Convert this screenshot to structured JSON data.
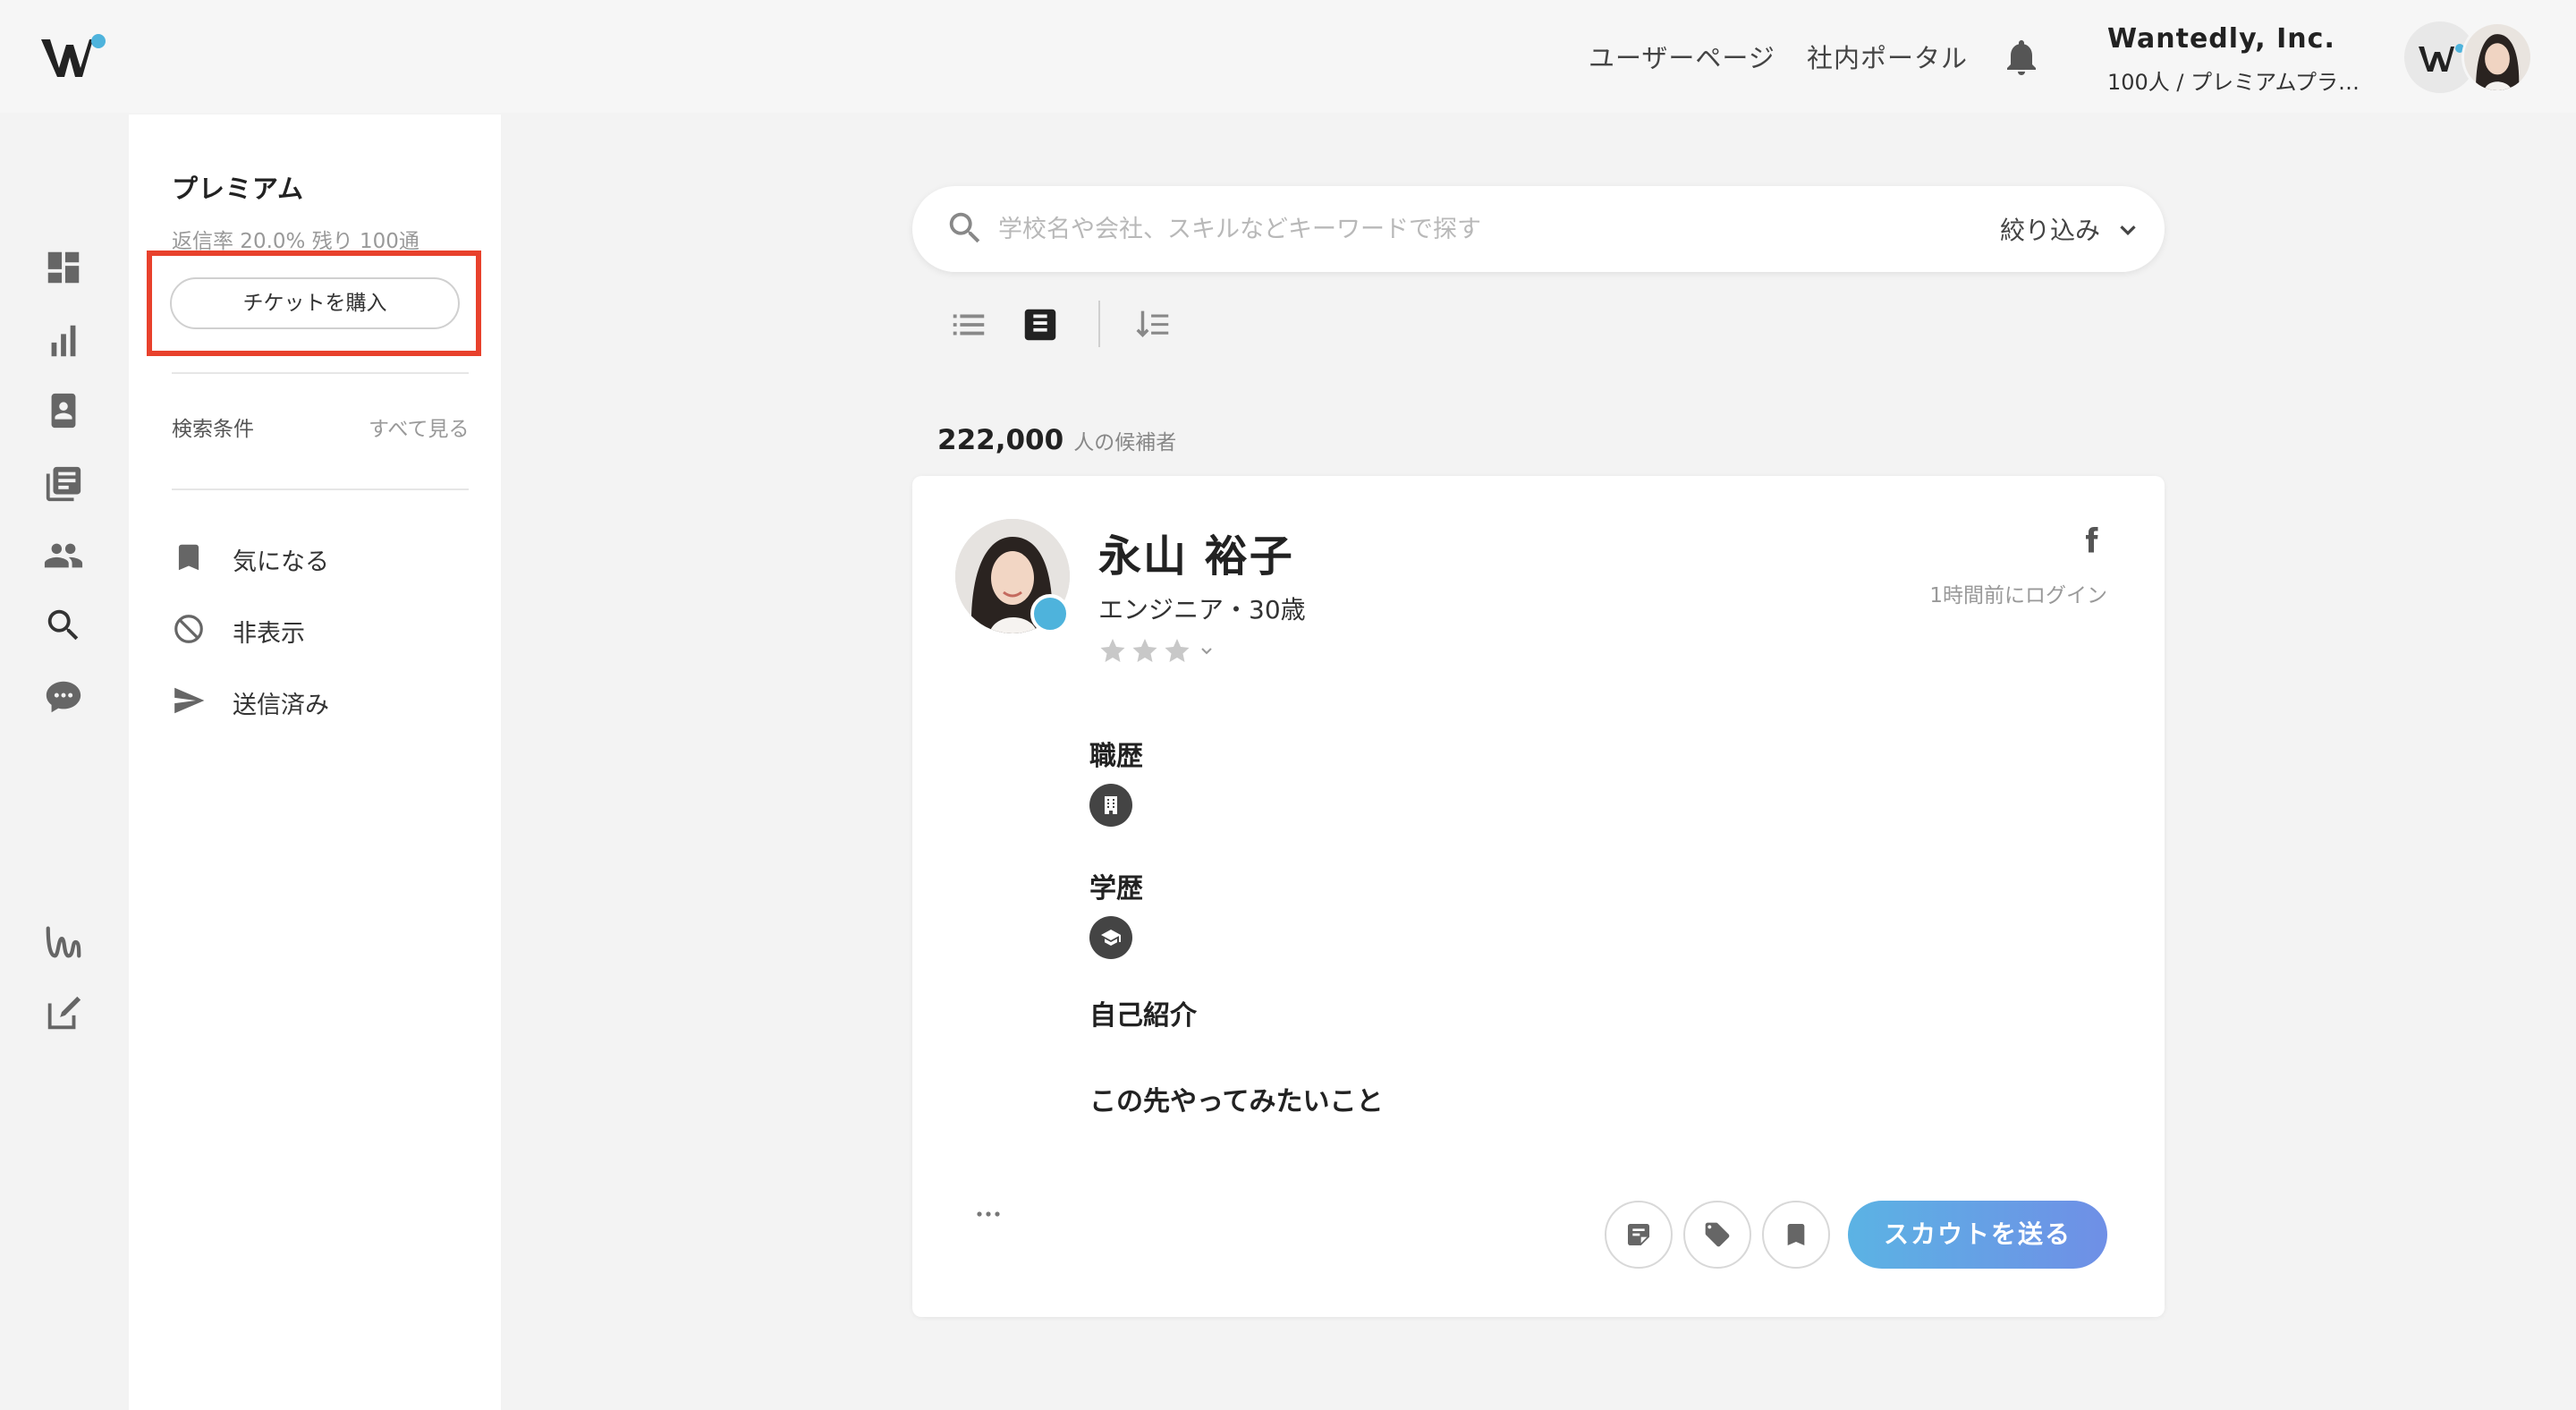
{
  "header": {
    "user_page": "ユーザーページ",
    "portal": "社内ポータル",
    "company_name": "Wantedly, Inc.",
    "company_plan": "100人 / プレミアムプラン ..."
  },
  "sidebar_icons": [
    "dashboard-icon",
    "analytics-icon",
    "profile-card-icon",
    "articles-icon",
    "people-icon",
    "search-icon",
    "chat-icon",
    "wantedly-brand-icon",
    "edit-icon"
  ],
  "panel": {
    "title": "プレミアム",
    "stats": "返信率 20.0%  残り 100通",
    "ticket_button": "チケットを購入",
    "search_conditions": "検索条件",
    "see_all": "すべて見る",
    "items": [
      {
        "label": "気になる",
        "icon": "bookmark-icon"
      },
      {
        "label": "非表示",
        "icon": "block-icon"
      },
      {
        "label": "送信済み",
        "icon": "send-icon"
      }
    ]
  },
  "search": {
    "placeholder": "学校名や会社、スキルなどキーワードで探す",
    "filter_label": "絞り込み"
  },
  "results": {
    "count": "222,000",
    "count_label": "人の候補者"
  },
  "candidate": {
    "name": "永山 裕子",
    "subtitle": "エンジニア・30歳",
    "rating_stars": 3,
    "last_login": "1時間前にログイン",
    "sections": {
      "career": "職歴",
      "education": "学歴",
      "intro": "自己紹介",
      "want_to_do": "この先やってみたいこと"
    },
    "scout_button": "スカウトを送る"
  },
  "colors": {
    "accent": "#4eb3dc",
    "highlight": "#e8412c",
    "scout_gradient_start": "#5bb3e4",
    "scout_gradient_end": "#6f8fe6"
  }
}
